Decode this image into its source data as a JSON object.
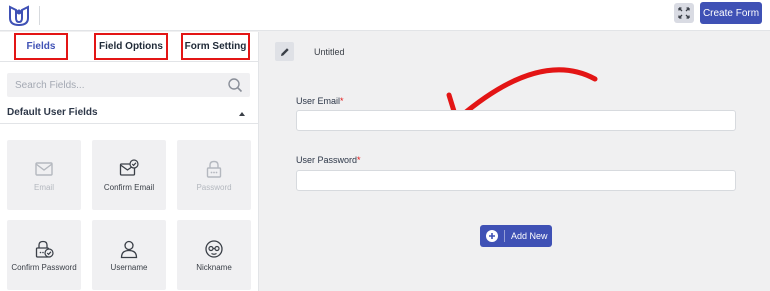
{
  "colors": {
    "accent": "#3f51b5",
    "highlight_border": "#e31515",
    "required": "#e31515"
  },
  "topbar": {
    "logo_icon": "user-registration-logo",
    "expand_icon": "fullscreen-expand-icon",
    "create_label": "Create Form"
  },
  "sidebar": {
    "tabs": [
      {
        "label": "Fields",
        "active": true
      },
      {
        "label": "Field Options",
        "active": false
      },
      {
        "label": "Form Setting",
        "active": false
      }
    ],
    "search": {
      "placeholder": "Search Fields...",
      "value": "",
      "icon": "search-icon"
    },
    "section_title": "Default User Fields",
    "fields": [
      {
        "label": "Email",
        "icon": "email-icon",
        "disabled": true
      },
      {
        "label": "Confirm Email",
        "icon": "confirm-email-icon",
        "disabled": false
      },
      {
        "label": "Password",
        "icon": "password-lock-icon",
        "disabled": true
      },
      {
        "label": "Confirm Password",
        "icon": "confirm-password-icon",
        "disabled": false
      },
      {
        "label": "Username",
        "icon": "user-icon",
        "disabled": false
      },
      {
        "label": "Nickname",
        "icon": "nickname-mask-icon",
        "disabled": false
      }
    ]
  },
  "main": {
    "edit_icon": "pencil-icon",
    "form_title": "Untitled",
    "form_fields": [
      {
        "label": "User Email",
        "required_mark": "*",
        "value": ""
      },
      {
        "label": "User Password",
        "required_mark": "*",
        "value": ""
      }
    ],
    "add_new_label": "Add New",
    "add_new_icon": "plus-circle-icon"
  }
}
